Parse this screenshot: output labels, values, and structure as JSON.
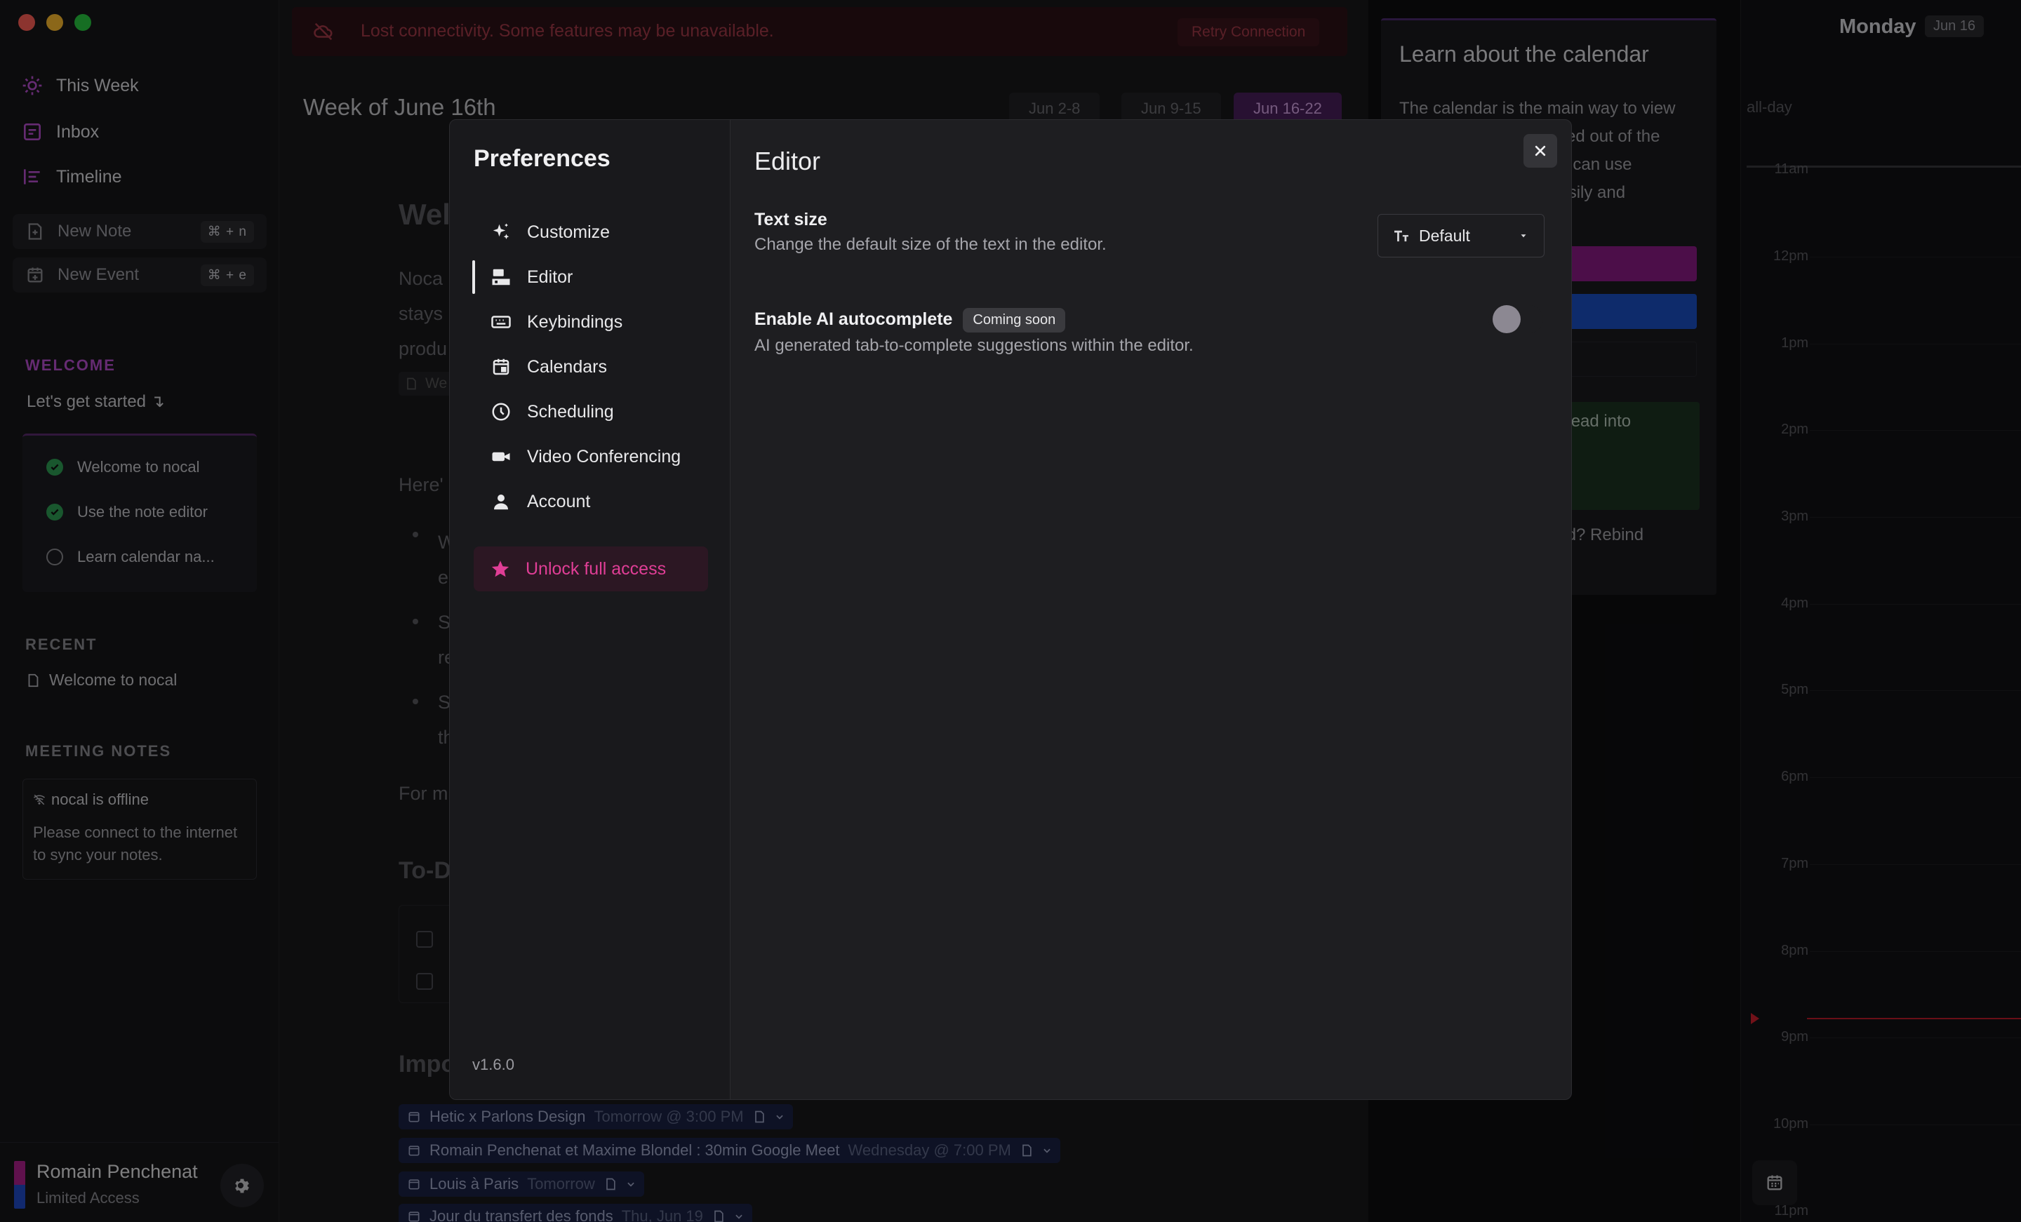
{
  "sidebar": {
    "nav": [
      {
        "label": "This Week",
        "icon": "sun-icon"
      },
      {
        "label": "Inbox",
        "icon": "inbox-icon"
      },
      {
        "label": "Timeline",
        "icon": "timeline-icon"
      }
    ],
    "new_note": {
      "label": "New Note",
      "shortcut": "⌘ + n"
    },
    "new_event": {
      "label": "New Event",
      "shortcut": "⌘ + e"
    },
    "welcome": {
      "heading": "WELCOME",
      "subtitle": "Let's get started ↴",
      "items": [
        {
          "label": "Welcome to nocal",
          "done": true
        },
        {
          "label": "Use the note editor",
          "done": true
        },
        {
          "label": "Learn calendar na...",
          "done": false
        }
      ]
    },
    "recent": {
      "heading": "RECENT",
      "items": [
        {
          "label": "Welcome to nocal"
        }
      ]
    },
    "meeting_notes": {
      "heading": "MEETING NOTES",
      "offline_title": "nocal is offline",
      "offline_desc": "Please connect to the internet to sync your notes."
    },
    "user": {
      "name": "Romain Penchenat",
      "plan": "Limited Access"
    }
  },
  "banner": {
    "message": "Lost connectivity. Some features may be unavailable.",
    "retry": "Retry Connection"
  },
  "week": {
    "title": "Week of June 16th",
    "ranges": [
      {
        "label": "Jun 2-8",
        "active": false
      },
      {
        "label": "Jun 9-15",
        "active": false
      },
      {
        "label": "Jun 16-22",
        "active": true
      }
    ]
  },
  "doc": {
    "heading": "Wel",
    "para": [
      "Noca",
      "stays",
      "produ"
    ],
    "chip": "We",
    "here": "Here'",
    "bullets": [
      "W",
      "e",
      "S",
      "re",
      "S",
      "th"
    ],
    "for_m": "For m",
    "todo": "To-D",
    "imp": "Impo",
    "events": [
      {
        "title": "Hetic x Parlons Design",
        "when": "Tomorrow @ 3:00 PM"
      },
      {
        "title": "Romain Penchenat et Maxime Blondel : 30min Google Meet",
        "when": "Wednesday @ 7:00 PM"
      },
      {
        "title": "Louis à Paris",
        "when": "Tomorrow"
      },
      {
        "title": "Jour du transfert des fonds",
        "when": "Thu, Jun 19"
      }
    ]
  },
  "tutorial": {
    "title": "Learn about the calendar",
    "lines": [
      "The calendar is the main way to view",
      "cked out of the",
      "ou can use",
      "easily and"
    ],
    "tip": "ahead into",
    "rebind": "oard? Rebind"
  },
  "calendar": {
    "day": "Monday",
    "date": "Jun 16",
    "allday": "all-day",
    "hours": [
      "11am",
      "12pm",
      "1pm",
      "2pm",
      "3pm",
      "4pm",
      "5pm",
      "6pm",
      "7pm",
      "8pm",
      "9pm",
      "10pm",
      "11pm"
    ]
  },
  "preferences": {
    "title": "Preferences",
    "nav": [
      {
        "label": "Customize",
        "icon": "sparkles-icon"
      },
      {
        "label": "Editor",
        "icon": "editor-icon",
        "active": true
      },
      {
        "label": "Keybindings",
        "icon": "keyboard-icon"
      },
      {
        "label": "Calendars",
        "icon": "calendar-icon"
      },
      {
        "label": "Scheduling",
        "icon": "clock-icon"
      },
      {
        "label": "Video Conferencing",
        "icon": "video-icon"
      },
      {
        "label": "Account",
        "icon": "user-icon"
      }
    ],
    "unlock": "Unlock full access",
    "version": "v1.6.0",
    "section": "Editor",
    "text_size": {
      "title": "Text size",
      "desc": "Change the default size of the text in the editor.",
      "value": "Default"
    },
    "ai": {
      "title": "Enable AI autocomplete",
      "badge": "Coming soon",
      "desc": "AI generated tab-to-complete suggestions within the editor.",
      "enabled": false
    }
  },
  "colors": {
    "accent": "#e03e96",
    "purple": "#b84fd0",
    "offline_red": "#a33a48",
    "event_blue": "#1a2244"
  }
}
